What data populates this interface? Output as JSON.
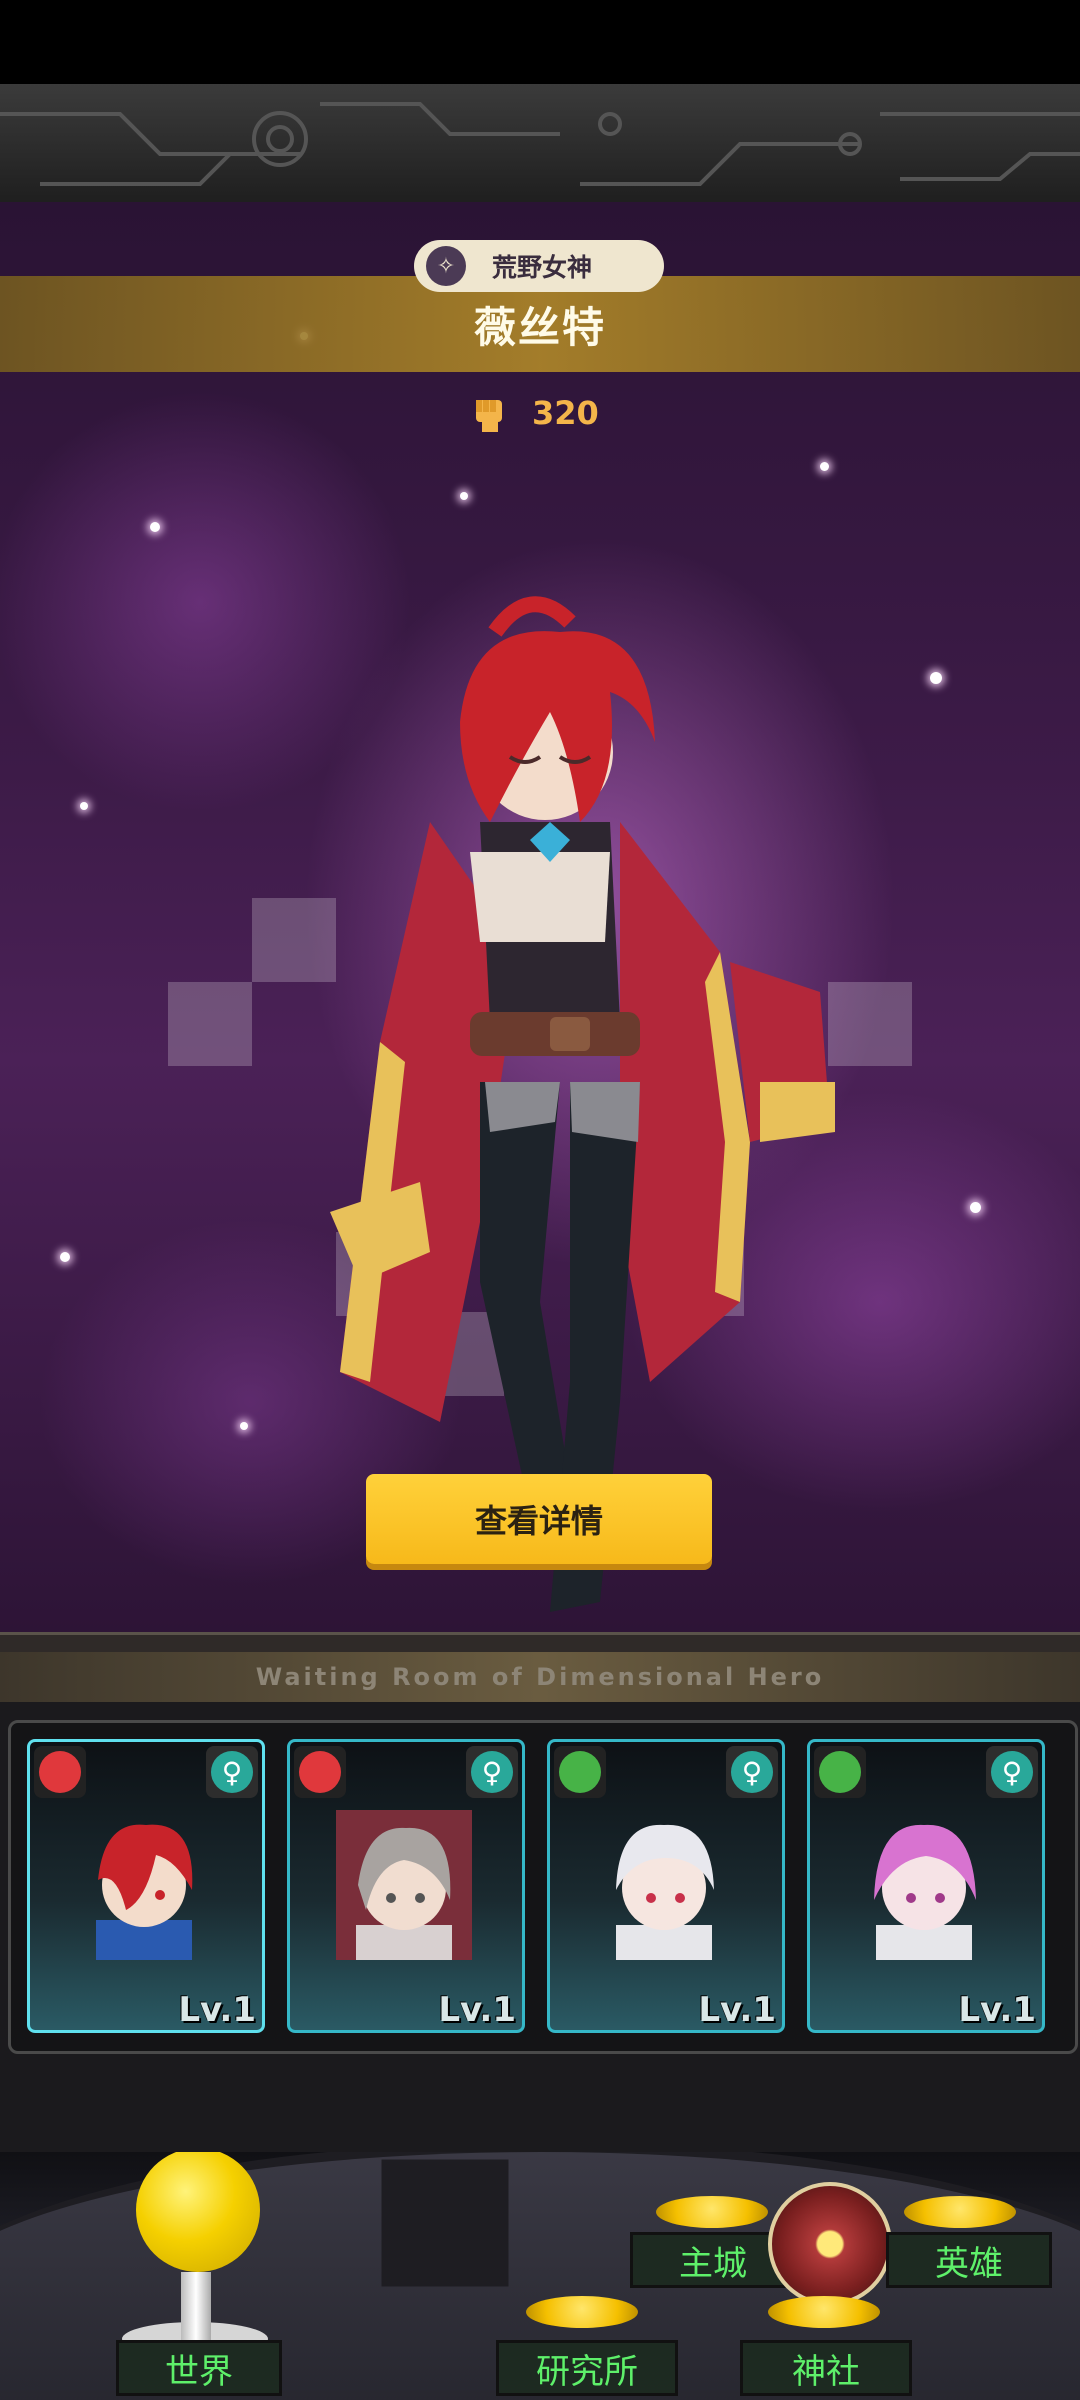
{
  "hero": {
    "faction": "荒野女神",
    "name": "薇丝特",
    "power": "320"
  },
  "detail_button": "查看详情",
  "waiting_room": {
    "title": "Waiting Room of Dimensional Hero",
    "cards": [
      {
        "class_color": "#e0383c",
        "level": "Lv.1",
        "gender": "♀",
        "selected": true
      },
      {
        "class_color": "#e0383c",
        "level": "Lv.1",
        "gender": "♀",
        "selected": false
      },
      {
        "class_color": "#47b347",
        "level": "Lv.1",
        "gender": "♀",
        "selected": false
      },
      {
        "class_color": "#47b347",
        "level": "Lv.1",
        "gender": "♀",
        "selected": false
      }
    ]
  },
  "nav": {
    "world": "世界",
    "institute": "研究所",
    "shrine": "神社",
    "castle": "主城",
    "heroes": "英雄"
  },
  "colors": {
    "accent_gold": "#f7b91a",
    "nav_text": "#5ef06a",
    "card_border": "#35b8c8"
  }
}
